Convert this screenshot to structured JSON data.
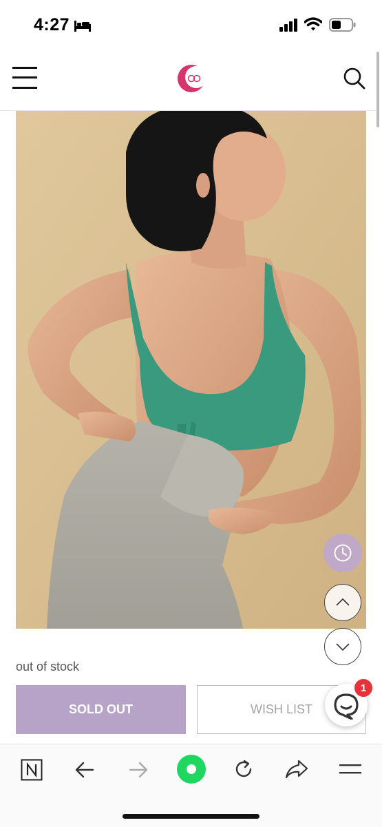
{
  "status_bar": {
    "time": "4:27"
  },
  "product": {
    "stock_status": "out of stock",
    "soldout_label": "SOLD OUT",
    "wishlist_label": "WISH LIST"
  },
  "chat": {
    "badge_count": "1"
  },
  "colors": {
    "accent_purple": "#b7a3c8",
    "logo_pink": "#d6346a",
    "browser_green": "#1ed760",
    "badge_red": "#e8323b"
  },
  "icons": {
    "header": [
      "menu-icon",
      "search-icon"
    ],
    "floating": [
      "clock-icon",
      "chevron-up-icon",
      "chevron-down-icon",
      "chat-icon"
    ],
    "toolbar": [
      "naver-n-icon",
      "back-arrow-icon",
      "forward-arrow-icon",
      "green-circle-icon",
      "refresh-icon",
      "share-icon",
      "menu-lines-icon"
    ]
  }
}
